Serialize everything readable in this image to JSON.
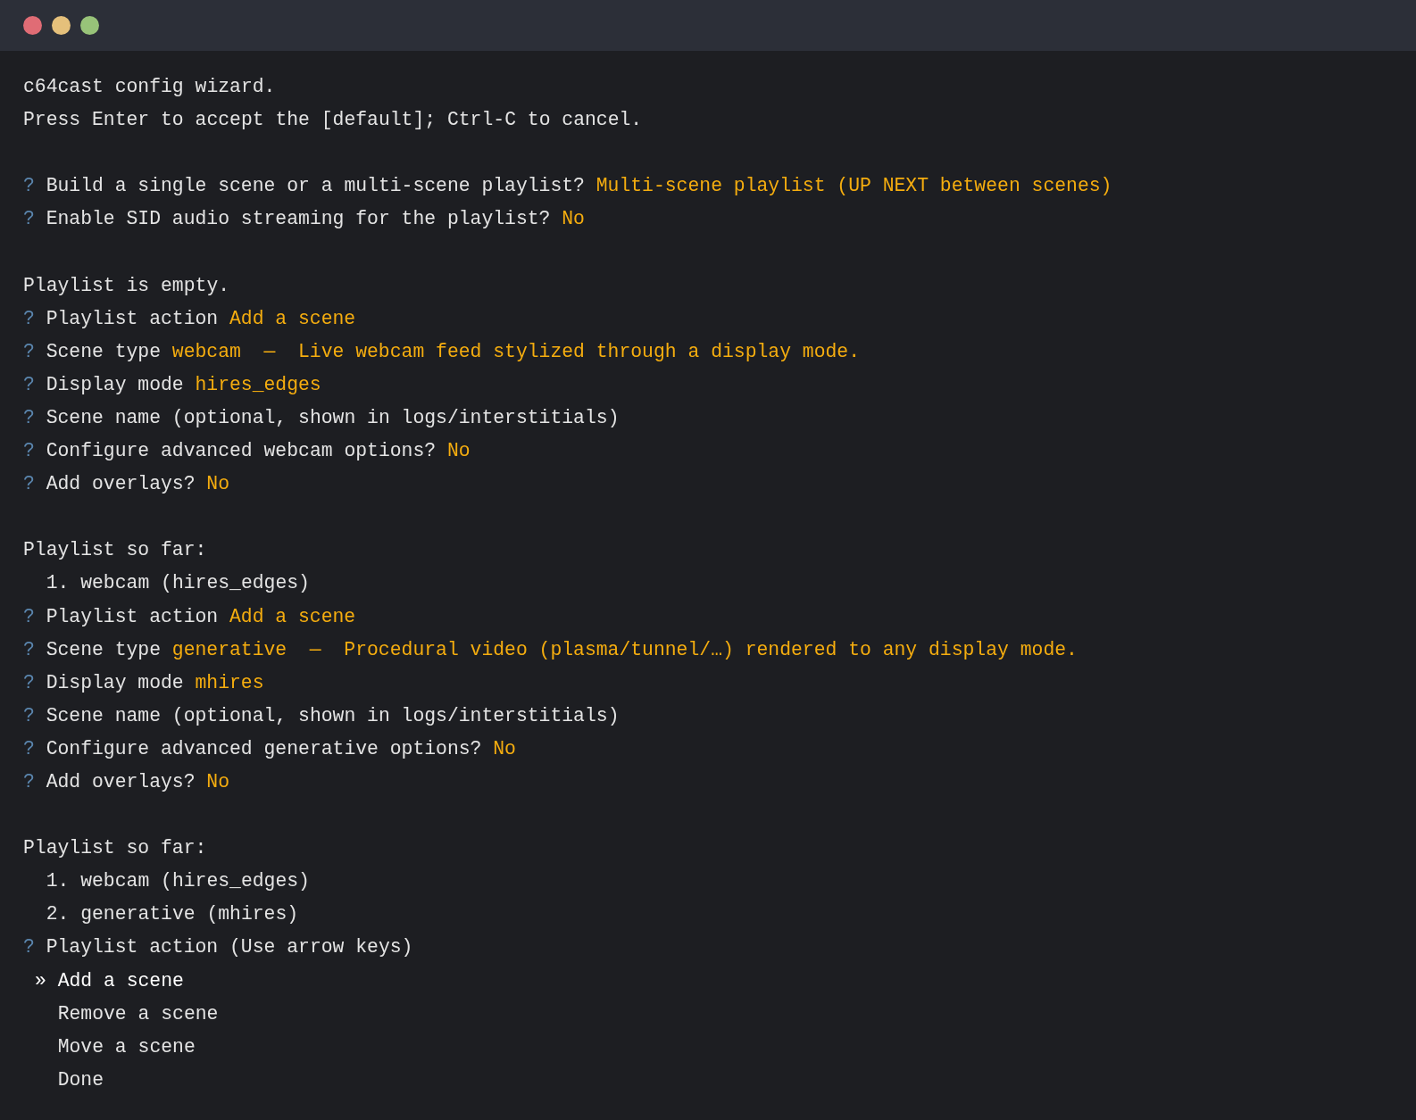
{
  "terminal": {
    "pointer": "»",
    "lines": [
      {
        "kind": "text",
        "text": "c64cast config wizard."
      },
      {
        "kind": "text",
        "text": "Press Enter to accept the [default]; Ctrl-C to cancel."
      },
      {
        "kind": "blank"
      },
      {
        "kind": "prompt",
        "mark": "?",
        "question": "Build a single scene or a multi-scene playlist?",
        "answer": "Multi-scene playlist (UP NEXT between scenes)"
      },
      {
        "kind": "prompt",
        "mark": "?",
        "question": "Enable SID audio streaming for the playlist?",
        "answer": "No"
      },
      {
        "kind": "blank"
      },
      {
        "kind": "text",
        "text": "Playlist is empty."
      },
      {
        "kind": "prompt",
        "mark": "?",
        "question": "Playlist action",
        "answer": "Add a scene"
      },
      {
        "kind": "prompt",
        "mark": "?",
        "question": "Scene type",
        "answer": "webcam  —  Live webcam feed stylized through a display mode."
      },
      {
        "kind": "prompt",
        "mark": "?",
        "question": "Display mode",
        "answer": "hires_edges"
      },
      {
        "kind": "prompt",
        "mark": "?",
        "question": "Scene name (optional, shown in logs/interstitials)"
      },
      {
        "kind": "prompt",
        "mark": "?",
        "question": "Configure advanced webcam options?",
        "answer": "No"
      },
      {
        "kind": "prompt",
        "mark": "?",
        "question": "Add overlays?",
        "answer": "No"
      },
      {
        "kind": "blank"
      },
      {
        "kind": "text",
        "text": "Playlist so far:"
      },
      {
        "kind": "list_item",
        "text": "1. webcam (hires_edges)"
      },
      {
        "kind": "prompt",
        "mark": "?",
        "question": "Playlist action",
        "answer": "Add a scene"
      },
      {
        "kind": "prompt",
        "mark": "?",
        "question": "Scene type",
        "answer": "generative  —  Procedural video (plasma/tunnel/…) rendered to any display mode."
      },
      {
        "kind": "prompt",
        "mark": "?",
        "question": "Display mode",
        "answer": "mhires"
      },
      {
        "kind": "prompt",
        "mark": "?",
        "question": "Scene name (optional, shown in logs/interstitials)"
      },
      {
        "kind": "prompt",
        "mark": "?",
        "question": "Configure advanced generative options?",
        "answer": "No"
      },
      {
        "kind": "prompt",
        "mark": "?",
        "question": "Add overlays?",
        "answer": "No"
      },
      {
        "kind": "blank"
      },
      {
        "kind": "text",
        "text": "Playlist so far:"
      },
      {
        "kind": "list_item",
        "text": "1. webcam (hires_edges)"
      },
      {
        "kind": "list_item",
        "text": "2. generative (mhires)"
      },
      {
        "kind": "prompt",
        "mark": "?",
        "question": "Playlist action (Use arrow keys)"
      },
      {
        "kind": "choice",
        "label": "Add a scene",
        "selected": true
      },
      {
        "kind": "choice",
        "label": "Remove a scene",
        "selected": false
      },
      {
        "kind": "choice",
        "label": "Move a scene",
        "selected": false
      },
      {
        "kind": "choice",
        "label": "Done",
        "selected": false
      }
    ]
  }
}
